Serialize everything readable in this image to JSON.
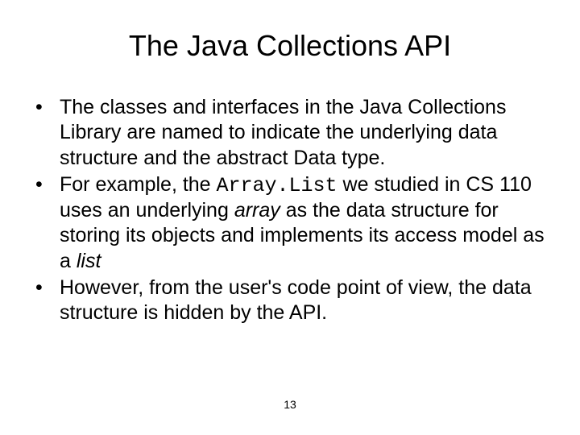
{
  "title": "The Java Collections API",
  "bullets": [
    {
      "runs": [
        {
          "text": "The classes and interfaces in the Java Collections Library are named to indicate the underlying data structure and the abstract Data type."
        }
      ]
    },
    {
      "runs": [
        {
          "text": "For example, the "
        },
        {
          "text": "Array.List",
          "style": "code"
        },
        {
          "text": " we studied in CS 110 uses an underlying "
        },
        {
          "text": "array",
          "style": "italic"
        },
        {
          "text": " as the data structure for storing its objects and implements its access model as a "
        },
        {
          "text": "list",
          "style": "italic"
        }
      ]
    },
    {
      "runs": [
        {
          "text": "However, from the user's code point of view, the data structure is hidden by the API."
        }
      ]
    }
  ],
  "page_number": "13"
}
